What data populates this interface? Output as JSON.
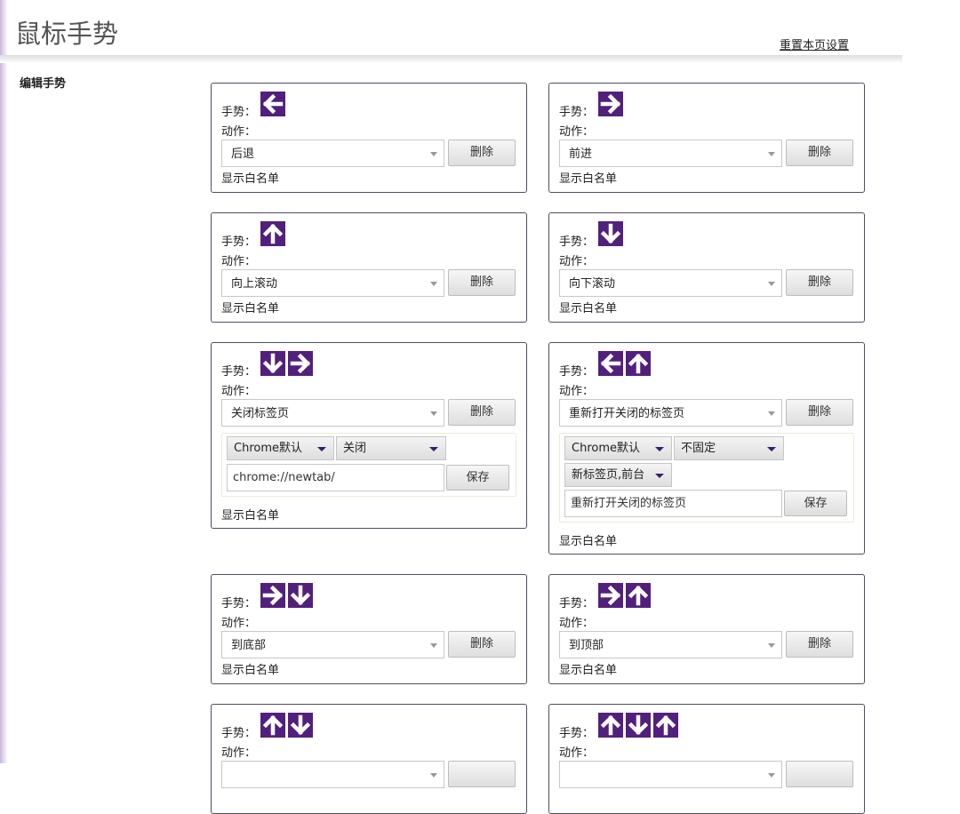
{
  "page": {
    "title": "鼠标手势",
    "reset_link": "重置本页设置"
  },
  "section": {
    "edit_label": "编辑手势"
  },
  "labels": {
    "gesture": "手势：",
    "action": "动作：",
    "delete": "删除",
    "whitelist": "显示白名单",
    "save": "保存"
  },
  "cards": [
    {
      "arrows": [
        "left"
      ],
      "action": "后退"
    },
    {
      "arrows": [
        "right"
      ],
      "action": "前进"
    },
    {
      "arrows": [
        "up"
      ],
      "action": "向上滚动"
    },
    {
      "arrows": [
        "down"
      ],
      "action": "向下滚动"
    },
    {
      "arrows": [
        "down",
        "right"
      ],
      "action": "关闭标签页",
      "options": {
        "mode": "Chrome默认",
        "pin": "关闭",
        "url": "chrome://newtab/"
      }
    },
    {
      "arrows": [
        "left",
        "up"
      ],
      "action": "重新打开关闭的标签页",
      "options": {
        "mode": "Chrome默认",
        "pin": "不固定",
        "position": "新标签页,前台",
        "url": "重新打开关闭的标签页"
      }
    },
    {
      "arrows": [
        "right",
        "down"
      ],
      "action": "到底部"
    },
    {
      "arrows": [
        "right",
        "up"
      ],
      "action": "到顶部"
    },
    {
      "arrows": [
        "up",
        "down"
      ],
      "action": ""
    },
    {
      "arrows": [
        "up",
        "down",
        "up"
      ],
      "action": ""
    }
  ],
  "colors": {
    "arrow_bg": "#52207c",
    "card_border": "#4e4f62"
  }
}
